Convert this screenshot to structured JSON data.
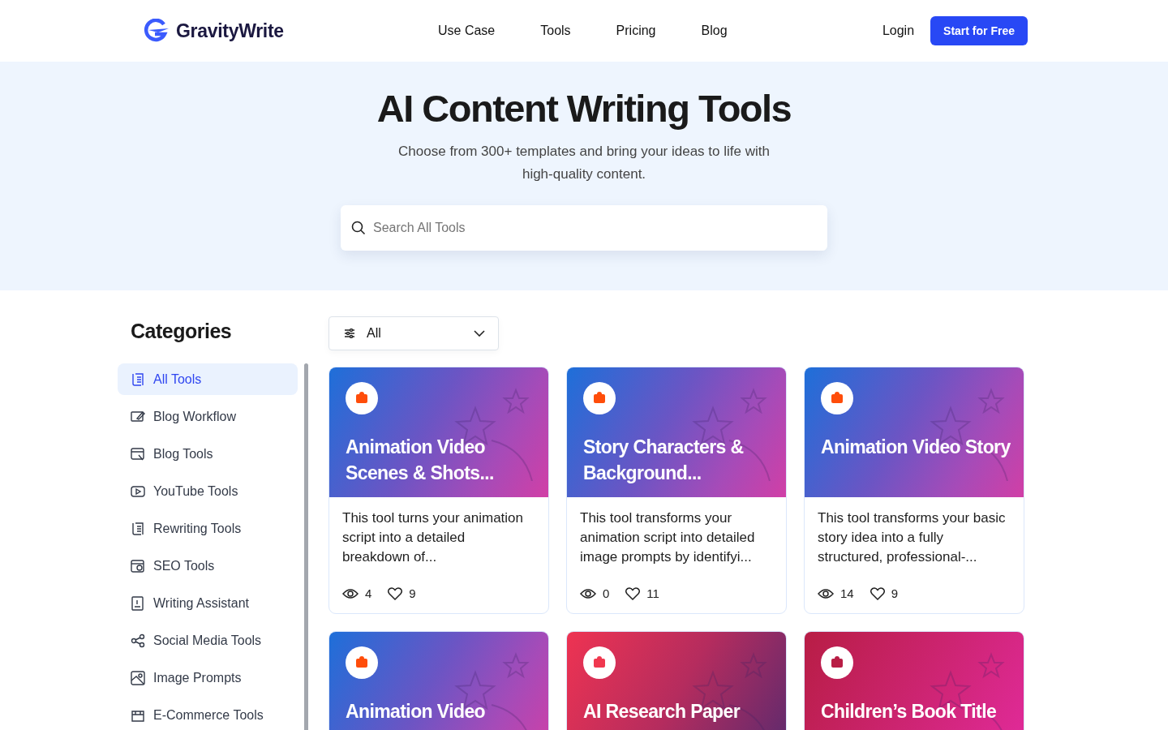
{
  "nav": {
    "brand": "GravityWrite",
    "links": [
      "Use Case",
      "Tools",
      "Pricing",
      "Blog"
    ],
    "login": "Login",
    "cta": "Start for Free"
  },
  "hero": {
    "title": "AI Content Writing Tools",
    "subtitle": "Choose from 300+ templates and bring your ideas to life with high-quality content.",
    "search": {
      "placeholder": "Search All Tools"
    }
  },
  "sidebar": {
    "title": "Categories",
    "items": [
      {
        "label": "All Tools",
        "selected": true
      },
      {
        "label": "Blog Workflow",
        "selected": false
      },
      {
        "label": "Blog Tools",
        "selected": false
      },
      {
        "label": "YouTube Tools",
        "selected": false
      },
      {
        "label": "Rewriting Tools",
        "selected": false
      },
      {
        "label": "SEO Tools",
        "selected": false
      },
      {
        "label": "Writing Assistant",
        "selected": false
      },
      {
        "label": "Social Media Tools",
        "selected": false
      },
      {
        "label": "Image Prompts",
        "selected": false
      },
      {
        "label": "E-Commerce Tools",
        "selected": false
      }
    ]
  },
  "filter": {
    "value": "All"
  },
  "cards": [
    {
      "kind": "blue",
      "title": "Animation Video Scenes & Shots...",
      "description": "This tool turns your animation script into a detailed breakdown of...",
      "views": "4",
      "likes": "9"
    },
    {
      "kind": "blue",
      "title": "Story Characters & Background...",
      "description": "This tool transforms your animation script into detailed image prompts by identifyi...",
      "views": "0",
      "likes": "11"
    },
    {
      "kind": "blue",
      "title": "Animation Video Story",
      "description": "This tool transforms your basic story idea into a fully structured, professional-...",
      "views": "14",
      "likes": "9"
    },
    {
      "kind": "blue",
      "title": "Animation Video"
    },
    {
      "kind": "red",
      "title": "AI Research Paper"
    },
    {
      "kind": "crimson",
      "title": "Children’s Book Title"
    }
  ]
}
